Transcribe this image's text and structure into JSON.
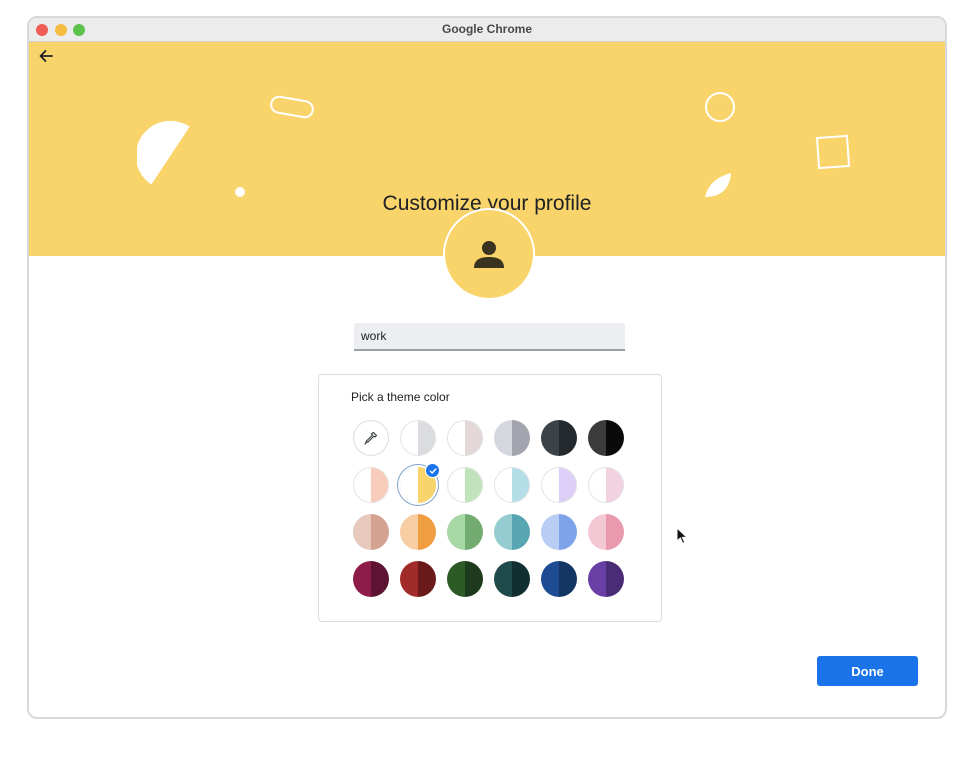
{
  "window": {
    "title": "Google Chrome"
  },
  "banner": {
    "heading": "Customize your profile",
    "color": "#f8d46a"
  },
  "profile": {
    "name_value": "work"
  },
  "theme_picker": {
    "title": "Pick a theme color",
    "selected_index": 1,
    "swatches": [
      {
        "type": "eyedropper",
        "icon": "eyedropper-icon"
      },
      {
        "left": "#ffffff",
        "right": "#dadce0"
      },
      {
        "left": "#ffffff",
        "right": "#e3d7d7"
      },
      {
        "left": "#d5d7de",
        "right": "#a2a4ae"
      },
      {
        "left": "#3c4348",
        "right": "#23292d"
      },
      {
        "left": "#3b3b3b",
        "right": "#0a0a0a"
      },
      {
        "left": "#ffffff",
        "right": "#f7ccbb"
      },
      {
        "left": "#ffffff",
        "right": "#f8d46a",
        "selected": true
      },
      {
        "left": "#ffffff",
        "right": "#c0e3bc"
      },
      {
        "left": "#ffffff",
        "right": "#b4dfe8"
      },
      {
        "left": "#ffffff",
        "right": "#ddcef8"
      },
      {
        "left": "#ffffff",
        "right": "#f2d2e0"
      },
      {
        "left": "#e8c9bd",
        "right": "#d4a290"
      },
      {
        "left": "#f7cda4",
        "right": "#ef9e42"
      },
      {
        "left": "#a9d8a7",
        "right": "#72ac70"
      },
      {
        "left": "#94ccd1",
        "right": "#57a6b2"
      },
      {
        "left": "#b9cdf4",
        "right": "#7ea3e9"
      },
      {
        "left": "#f4c8d3",
        "right": "#e99aae"
      },
      {
        "left": "#8d1d48",
        "right": "#5e1333"
      },
      {
        "left": "#a02b28",
        "right": "#6b1a1c"
      },
      {
        "left": "#2d5a26",
        "right": "#1d3a1c"
      },
      {
        "left": "#1f4a4a",
        "right": "#112f31"
      },
      {
        "left": "#1d4c94",
        "right": "#143665"
      },
      {
        "left": "#6a3fa5",
        "right": "#4a2b76"
      }
    ]
  },
  "actions": {
    "done_label": "Done",
    "done_color": "#1a73e8"
  }
}
